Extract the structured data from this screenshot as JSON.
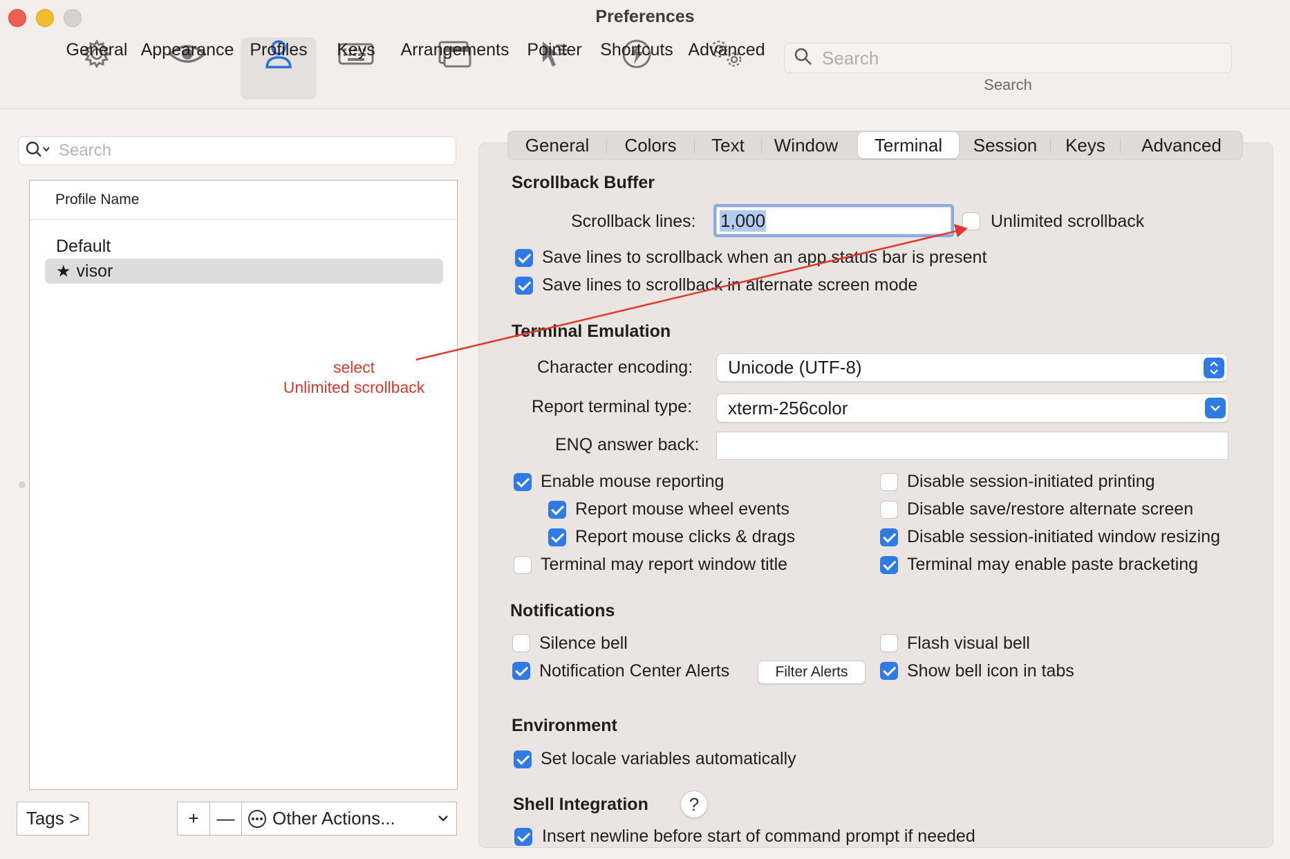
{
  "window": {
    "title": "Preferences"
  },
  "toolbar": {
    "items": [
      {
        "label": "General",
        "icon": "gear-icon"
      },
      {
        "label": "Appearance",
        "icon": "eye-icon"
      },
      {
        "label": "Profiles",
        "icon": "person-icon",
        "active": true
      },
      {
        "label": "Keys",
        "icon": "keyboard-icon"
      },
      {
        "label": "Arrangements",
        "icon": "windows-icon"
      },
      {
        "label": "Pointer",
        "icon": "pointer-icon"
      },
      {
        "label": "Shortcuts",
        "icon": "lightning-icon"
      },
      {
        "label": "Advanced",
        "icon": "gears-icon"
      }
    ],
    "search": {
      "placeholder": "Search",
      "label": "Search"
    },
    "accent": "#2a6fd6"
  },
  "left": {
    "search_placeholder": "Search",
    "column_header": "Profile Name",
    "profiles": [
      {
        "name": "Default",
        "selected": false,
        "starred": false
      },
      {
        "name": "visor",
        "selected": true,
        "starred": true,
        "star": "★"
      }
    ],
    "tags_button": "Tags >",
    "add_label": "+",
    "remove_label": "—",
    "other_actions": "Other Actions..."
  },
  "tabs": [
    "General",
    "Colors",
    "Text",
    "Window",
    "Terminal",
    "Session",
    "Keys",
    "Advanced"
  ],
  "active_tab": "Terminal",
  "scrollback": {
    "title": "Scrollback Buffer",
    "lines_label": "Scrollback lines:",
    "lines_value": "1,000",
    "unlimited_label": "Unlimited scrollback",
    "unlimited_checked": false,
    "save_status_bar": "Save lines to scrollback when an app status bar is present",
    "save_alternate": "Save lines to scrollback in alternate screen mode"
  },
  "emulation": {
    "title": "Terminal Emulation",
    "encoding_label": "Character encoding:",
    "encoding_value": "Unicode (UTF-8)",
    "report_type_label": "Report terminal type:",
    "report_type_value": "xterm-256color",
    "enq_label": "ENQ answer back:",
    "enq_value": "",
    "left_options": [
      {
        "label": "Enable mouse reporting",
        "checked": true
      },
      {
        "label": "Report mouse wheel events",
        "checked": true
      },
      {
        "label": "Report mouse clicks & drags",
        "checked": true
      },
      {
        "label": "Terminal may report window title",
        "checked": false
      }
    ],
    "right_options": [
      {
        "label": "Disable session-initiated printing",
        "checked": false
      },
      {
        "label": "Disable save/restore alternate screen",
        "checked": false
      },
      {
        "label": "Disable session-initiated window resizing",
        "checked": true
      },
      {
        "label": "Terminal may enable paste bracketing",
        "checked": true
      }
    ]
  },
  "notifications": {
    "title": "Notifications",
    "silence_bell": "Silence bell",
    "nc_alerts": "Notification Center Alerts",
    "filter_alerts": "Filter Alerts",
    "flash_bell": "Flash visual bell",
    "bell_icon_tabs": "Show bell icon in tabs"
  },
  "environment": {
    "title": "Environment",
    "locale": "Set locale variables automatically"
  },
  "shell_integration": {
    "title": "Shell Integration",
    "help": "?",
    "insert_newline": "Insert newline before start of command prompt if needed"
  },
  "annotation": {
    "line1": "select",
    "line2": "Unlimited scrollback",
    "color": "#e0372b"
  }
}
